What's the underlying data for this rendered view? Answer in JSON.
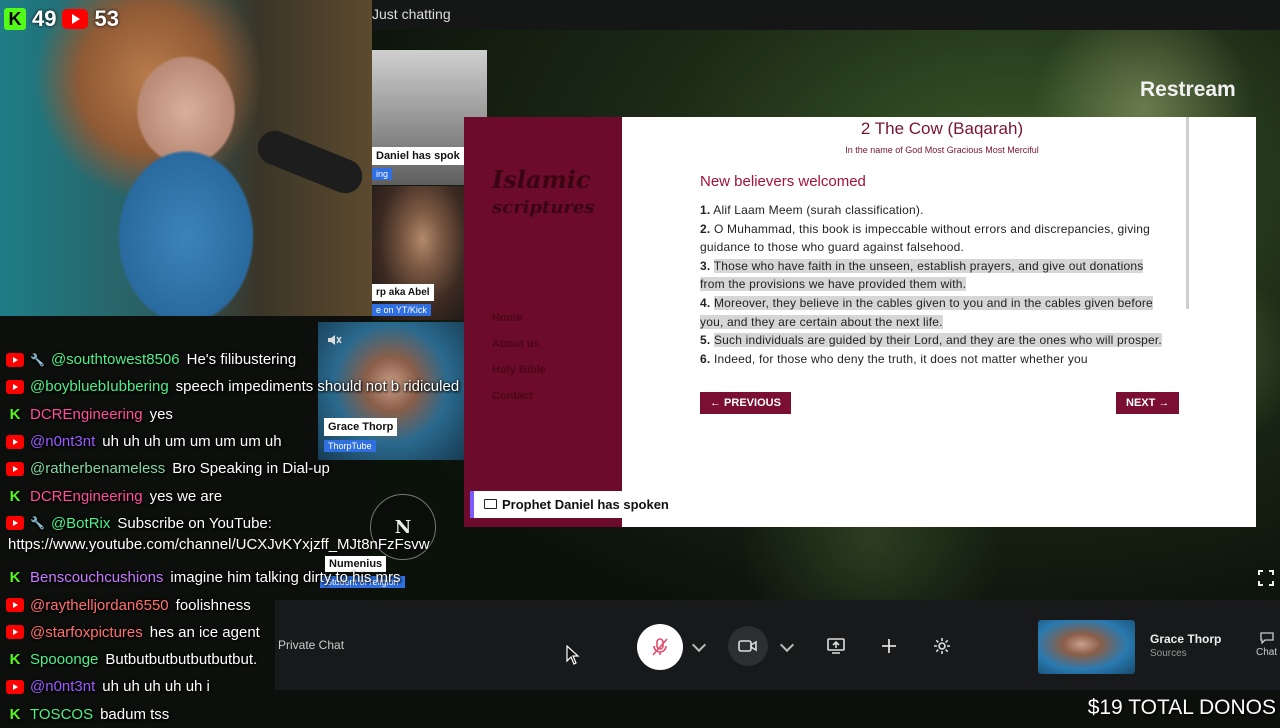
{
  "top_bar": {
    "title": "Just chatting"
  },
  "counts": {
    "kick_glyph": "K",
    "kick_viewers": "49",
    "youtube_viewers": "53"
  },
  "brand": {
    "restream": "Restream"
  },
  "participants": {
    "daniel": {
      "name": "Daniel has spok",
      "badge": "ing"
    },
    "abel": {
      "name": "rp aka Abel",
      "badge": "e on YT/Kick"
    },
    "grace": {
      "name": "Grace Thorp",
      "badge": "ThorpTube"
    },
    "numenius": {
      "initial": "N",
      "name": "Numenius",
      "badge": "Student of religion"
    }
  },
  "screen_share": {
    "label": "Prophet Daniel has spoken",
    "site_logo_line1": "Islamic",
    "site_logo_line2": "scriptures",
    "side_links": [
      "Home",
      "About us",
      "Holy Bible",
      "Contact"
    ],
    "surah_title": "2 The Cow (Baqarah)",
    "surah_subtitle": "In the name of God Most Gracious Most Merciful",
    "section_heading": "New believers welcomed",
    "verses": [
      {
        "num": "1.",
        "text": "Alif Laam Meem (surah classification)."
      },
      {
        "num": "2.",
        "text": "O Muhammad, this book is impeccable without errors and discrepancies, giving guidance to those who guard against falsehood."
      },
      {
        "num": "3.",
        "text": "Those who have faith in the unseen, establish prayers, and give out donations from the provisions we have provided them with."
      },
      {
        "num": "4.",
        "text": "Moreover, they believe in the cables given to you and in the cables given before you, and they are certain about the next life."
      },
      {
        "num": "5.",
        "text": "Such individuals are guided by their Lord, and they are the ones who will prosper."
      },
      {
        "num": "6.",
        "text": "Indeed, for those who deny the truth, it does not matter whether you"
      }
    ],
    "prev_label": "← PREVIOUS",
    "next_label": "NEXT →"
  },
  "chat": {
    "messages": [
      {
        "source": "youtube",
        "wrench": true,
        "user": "@southtowest8506",
        "color": "#4ef08a",
        "text": "He's filibustering"
      },
      {
        "source": "youtube",
        "wrench": false,
        "user": "@boybluebIubbering",
        "color": "#4ef08a",
        "text": "speech impediments should not b ridiculed"
      },
      {
        "source": "kick",
        "wrench": false,
        "user": "DCREngineering",
        "color": "#ff4f9a",
        "text": "yes"
      },
      {
        "source": "youtube",
        "wrench": false,
        "user": "@n0nt3nt",
        "color": "#9a5cff",
        "text": "uh uh uh um um um um uh"
      },
      {
        "source": "youtube",
        "wrench": false,
        "user": "@ratherbenameless",
        "color": "#7fd6a0",
        "text": "Bro Speaking in Dial-up"
      },
      {
        "source": "kick",
        "wrench": false,
        "user": "DCREngineering",
        "color": "#ff4f9a",
        "text": "yes we are"
      },
      {
        "source": "youtube",
        "wrench": true,
        "user": "@BotRix",
        "color": "#4ef08a",
        "text": "Subscribe on YouTube:"
      },
      {
        "source": "kick",
        "wrench": false,
        "user": "Benscouchcushions",
        "color": "#c57bff",
        "text": "imagine him talking dirty to his mrs"
      },
      {
        "source": "youtube",
        "wrench": false,
        "user": "@raythelljordan6550",
        "color": "#ff7070",
        "text": "foolishness"
      },
      {
        "source": "youtube",
        "wrench": false,
        "user": "@starfoxpictures",
        "color": "#ff7070",
        "text": "hes an ice agent"
      },
      {
        "source": "kick",
        "wrench": false,
        "user": "Spooonge",
        "color": "#4ef08a",
        "text": "Butbutbutbutbutbutbut."
      },
      {
        "source": "youtube",
        "wrench": false,
        "user": "@n0nt3nt",
        "color": "#9a5cff",
        "text": "uh uh uh uh uh i"
      },
      {
        "source": "kick",
        "wrench": false,
        "user": "TOSCOS",
        "color": "#4ef08a",
        "text": "badum tss"
      }
    ],
    "botrix_link": "https://www.youtube.com/channel/UCXJvKYxjzff_MJt8nFzFsvw"
  },
  "controls": {
    "private_chat": "Private Chat",
    "self_name": "Grace Thorp",
    "self_sub": "Sources",
    "chat_label": "Chat"
  },
  "donos": "$19 TOTAL DONOS",
  "colors": {
    "accent": "#7a0f33",
    "kick": "#53fc18",
    "youtube": "#ff0000",
    "restream_label_bar": "#7b5cff"
  }
}
